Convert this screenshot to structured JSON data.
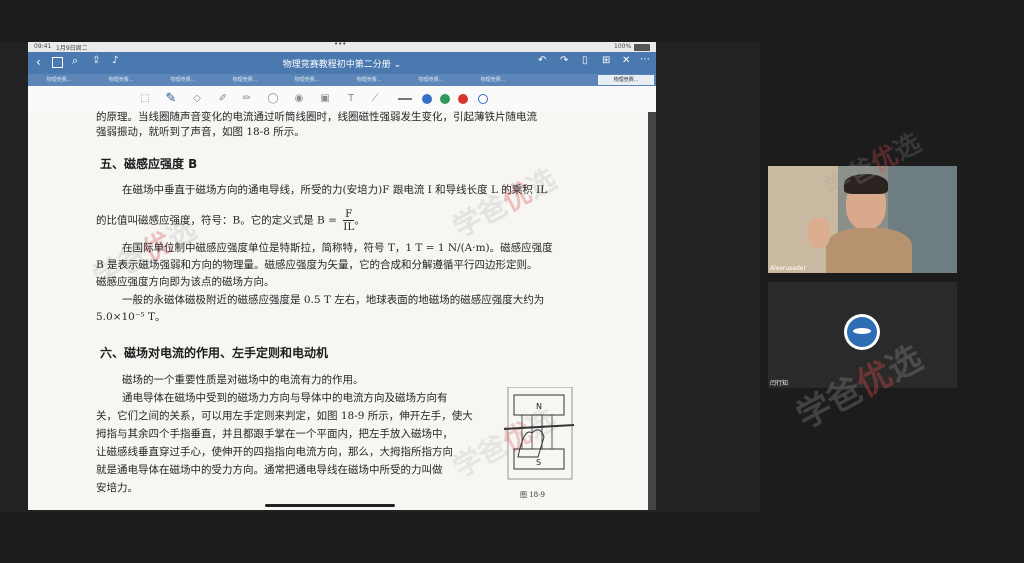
{
  "status": {
    "time": "09:41",
    "date": "1月9日周二",
    "battery": "100%"
  },
  "nav": {
    "title": "物理竞赛教程初中第二分册",
    "title_arrow": "⌄",
    "more_dots": "•••"
  },
  "tabs": [
    {
      "label": "物理竞赛..."
    },
    {
      "label": "物理竞赛..."
    },
    {
      "label": "物理竞赛..."
    },
    {
      "label": "物理竞赛..."
    },
    {
      "label": "物理竞赛..."
    },
    {
      "label": "物理竞赛..."
    },
    {
      "label": "物理竞赛..."
    },
    {
      "label": "物理竞赛..."
    },
    {
      "label": "物理竞赛..."
    }
  ],
  "toolbar_colors": {
    "blue": "#3b6fc7",
    "green": "#2f9a5c",
    "red": "#d8342e"
  },
  "document": {
    "top_line_1": "的原理。当线圈随声音变化的电流通过听筒线圈时，线圈磁性强弱发生变化，引起薄铁片随电流",
    "top_line_2": "强弱振动，就听到了声音，如图 18-8 所示。",
    "heading_5": "五、磁感应强度 B",
    "p5_l1": "在磁场中垂直于磁场方向的通电导线，所受的力(安培力)F 跟电流 I 和导线长度 L 的乘积 IL",
    "p5_l2": "的比值叫磁感应强度，符号：B。它的定义式是 B =",
    "formula_num": "F",
    "formula_den": "IL",
    "formula_end": "。",
    "p5_l3": "在国际单位制中磁感应强度单位是特斯拉，简称特，符号 T，1 T = 1 N/(A·m)。磁感应强度",
    "p5_l4": "B 是表示磁场强弱和方向的物理量。磁感应强度为矢量，它的合成和分解遵循平行四边形定则。",
    "p5_l5": "磁感应强度方向即为该点的磁场方向。",
    "p5_l6": "一般的永磁体磁极附近的磁感应强度是 0.5 T 左右，地球表面的地磁场的磁感应强度大约为",
    "p5_l7": "5.0×10⁻⁵ T。",
    "heading_6": "六、磁场对电流的作用、左手定则和电动机",
    "p6_l1": "磁场的一个重要性质是对磁场中的电流有力的作用。",
    "p6_l2": "通电导体在磁场中受到的磁场力方向与导体中的电流方向及磁场方向有",
    "p6_l3": "关，它们之间的关系，可以用左手定则来判定，如图 18-9 所示，伸开左手，使大",
    "p6_l4": "拇指与其余四个手指垂直，并且都跟手掌在一个平面内，把左手放入磁场中，",
    "p6_l5": "让磁感线垂直穿过手心，使伸开的四指指向电流方向，那么，大拇指所指方向",
    "p6_l6": "就是通电导体在磁场中的受力方向。通常把通电导线在磁场中所受的力叫做",
    "p6_l7": "安培力。",
    "figure_caption": "图 18-9",
    "figure_N": "N",
    "figure_S": "S"
  },
  "watermark": {
    "char1": "学",
    "char2": "爸",
    "char3": "优",
    "char4": "选"
  },
  "participants": [
    {
      "name": "Alexrusader"
    },
    {
      "name": "闫行知"
    }
  ]
}
